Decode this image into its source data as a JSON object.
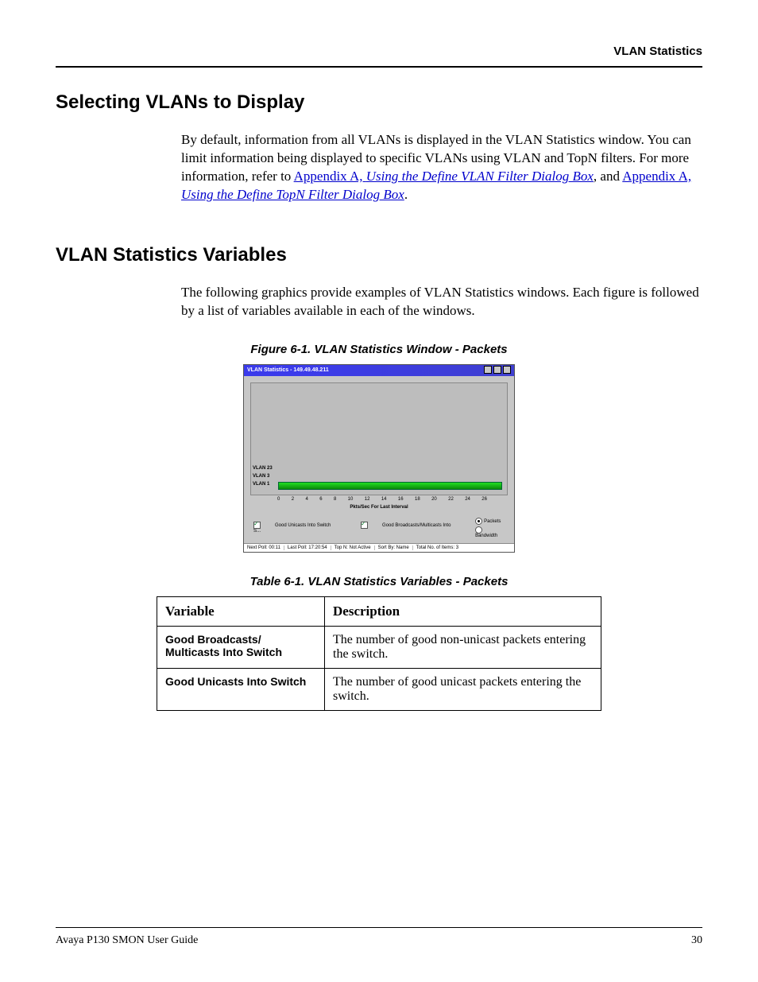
{
  "header": {
    "running": "VLAN Statistics"
  },
  "section1": {
    "title": "Selecting VLANs to Display",
    "para_pre": "By default, information from all VLANs is displayed in the VLAN Statistics window. You can limit information being displayed to specific VLANs using VLAN and TopN filters. For more information, refer to ",
    "link1_plain": "Appendix A,",
    "link1_ital": "Using the Define VLAN Filter Dialog Box",
    "para_mid": ", and ",
    "link2_plain": "Appendix A,",
    "link2_ital": "Using the Define TopN Filter Dialog Box",
    "para_end": "."
  },
  "section2": {
    "title": "VLAN Statistics Variables",
    "para": "The following graphics provide examples of VLAN Statistics windows. Each figure is followed by a list of variables available in each of the windows."
  },
  "figure": {
    "caption": "Figure 6-1.  VLAN Statistics Window - Packets",
    "win_title": "VLAN Statistics - 149.49.48.211",
    "ylabels": [
      "VLAN 23",
      "VLAN 3",
      "VLAN 1"
    ],
    "xticks": [
      "0",
      "2",
      "4",
      "6",
      "8",
      "10",
      "12",
      "14",
      "16",
      "18",
      "20",
      "22",
      "24",
      "26"
    ],
    "axis_caption": "Pkts/Sec For Last Interval",
    "legend_checks": [
      "Good Unicasts Into Switch",
      "Good Broadcasts/Multicasts Into S..."
    ],
    "radio_packets": "Packets",
    "radio_bandwidth": "Bandwidth",
    "status": {
      "next_poll": "Next Poll: 00:11",
      "last_poll": "Last Poll: 17:20:54",
      "topn": "Top N: Not Active",
      "sort": "Sort By: Name",
      "total": "Total No. of Items: 3"
    }
  },
  "chart_data": {
    "type": "bar",
    "orientation": "horizontal",
    "categories": [
      "VLAN 23",
      "VLAN 3",
      "VLAN 1"
    ],
    "series": [
      {
        "name": "Good Unicasts Into Switch",
        "values": [
          0,
          0,
          26
        ]
      },
      {
        "name": "Good Broadcasts/Multicasts Into Switch",
        "values": [
          0,
          0,
          0
        ]
      }
    ],
    "xlabel": "Pkts/Sec For Last Interval",
    "ylabel": "",
    "xlim": [
      0,
      26
    ],
    "title": "VLAN Statistics - 149.49.48.211"
  },
  "table": {
    "caption": "Table 6-1.  VLAN Statistics Variables - Packets",
    "head": {
      "c1": "Variable",
      "c2": "Description"
    },
    "rows": [
      {
        "v": "Good Broadcasts/ Multicasts Into Switch",
        "d": "The number of good non-unicast packets entering the switch."
      },
      {
        "v": "Good Unicasts Into Switch",
        "d": "The number of good unicast packets entering the switch."
      }
    ]
  },
  "footer": {
    "left": "Avaya P130 SMON User Guide",
    "right": "30"
  }
}
